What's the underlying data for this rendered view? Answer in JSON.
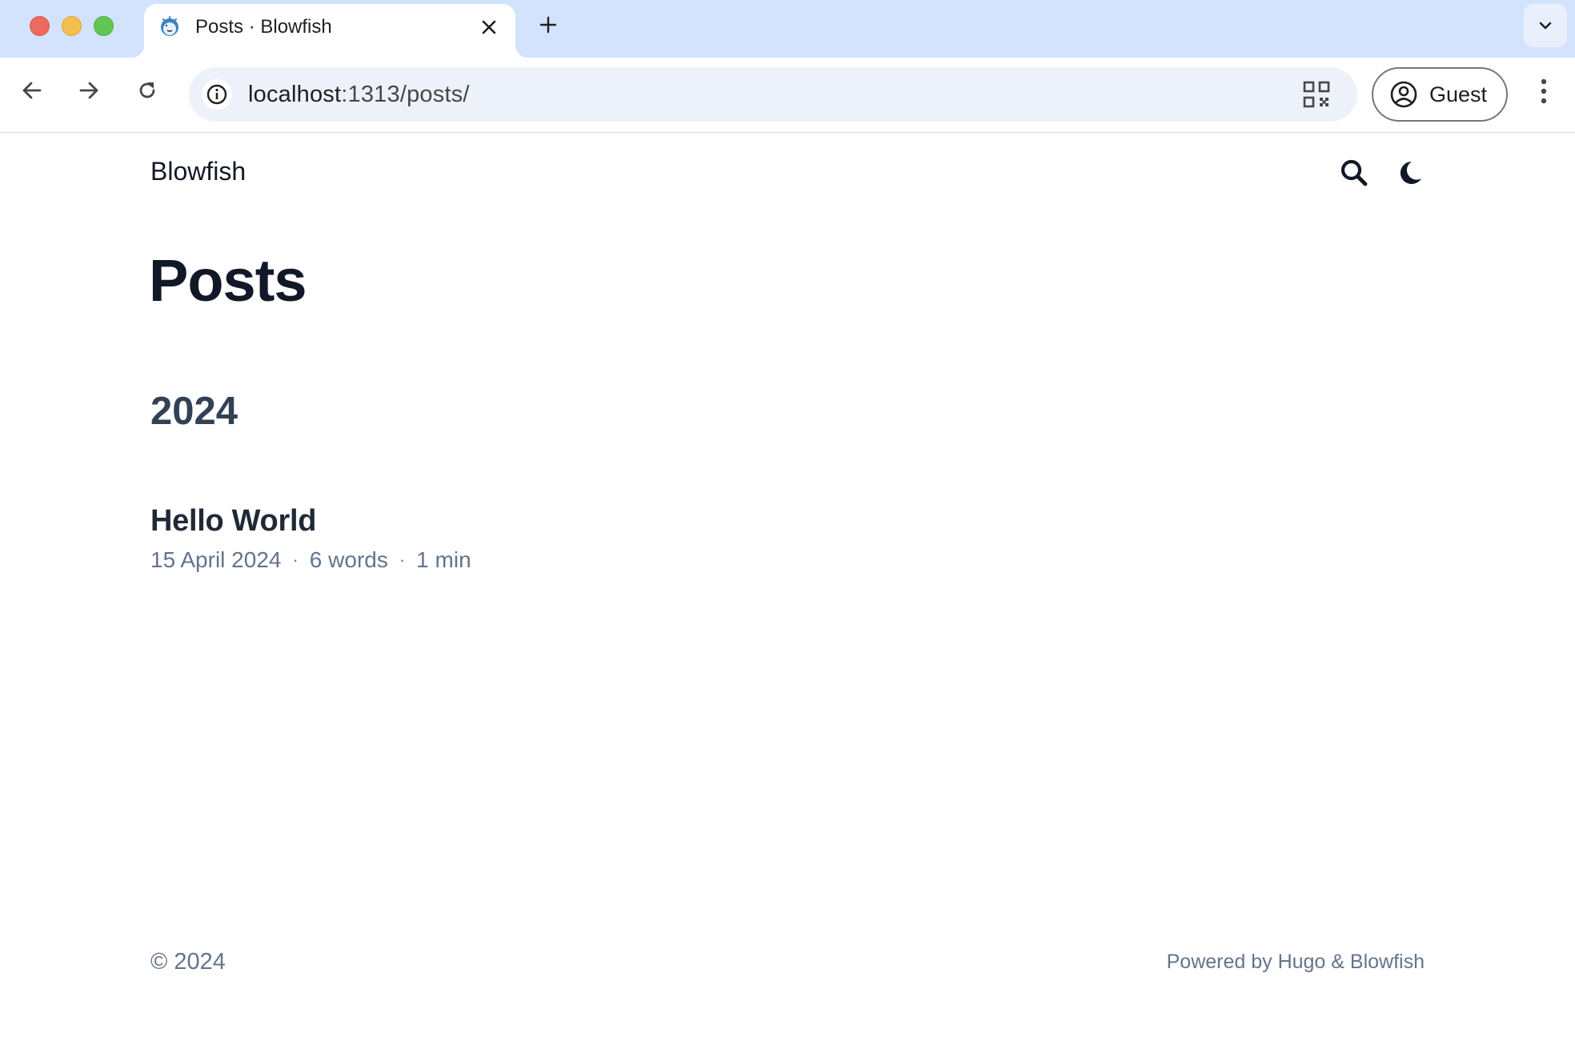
{
  "browser": {
    "tab": {
      "title": "Posts · Blowfish",
      "favicon": "blowfish-favicon-icon"
    },
    "url": {
      "host": "localhost",
      "path": ":1313/posts/"
    },
    "profile_label": "Guest",
    "icons": {
      "back": "arrow-left-icon",
      "forward": "arrow-right-icon",
      "reload": "reload-icon",
      "site_info": "info-icon",
      "qr": "qr-code-icon",
      "new_tab": "plus-icon",
      "tab_search": "chevron-down-icon",
      "menu": "kebab-menu-icon"
    },
    "colors": {
      "tabstrip": "#d3e3fd",
      "omnibox": "#edf2fa"
    }
  },
  "site": {
    "name": "Blowfish",
    "icons": {
      "search": "search-icon",
      "theme": "moon-icon"
    }
  },
  "main": {
    "title": "Posts",
    "groups": [
      {
        "year": "2024",
        "posts": [
          {
            "title": "Hello World",
            "date": "15 April 2024",
            "separator": "·",
            "words": "6 words",
            "reading_time": "1 min"
          }
        ]
      }
    ]
  },
  "footer": {
    "copyright": "© 2024",
    "powered_by": "Powered by Hugo & Blowfish"
  }
}
